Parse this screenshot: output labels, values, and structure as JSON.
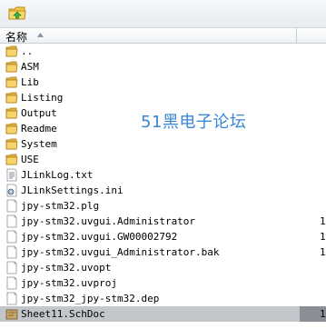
{
  "header": {
    "name_column": "名称"
  },
  "watermark": "51黑电子论坛",
  "files": [
    {
      "name": "..",
      "type": "folder",
      "size": ""
    },
    {
      "name": "ASM",
      "type": "folder",
      "size": ""
    },
    {
      "name": "Lib",
      "type": "folder",
      "size": ""
    },
    {
      "name": "Listing",
      "type": "folder",
      "size": ""
    },
    {
      "name": "Output",
      "type": "folder",
      "size": ""
    },
    {
      "name": "Readme",
      "type": "folder",
      "size": ""
    },
    {
      "name": "System",
      "type": "folder",
      "size": ""
    },
    {
      "name": "USE",
      "type": "folder",
      "size": ""
    },
    {
      "name": "JLinkLog.txt",
      "type": "text",
      "size": ""
    },
    {
      "name": "JLinkSettings.ini",
      "type": "settings",
      "size": ""
    },
    {
      "name": "jpy-stm32.plg",
      "type": "file",
      "size": ""
    },
    {
      "name": "jpy-stm32.uvgui.Administrator",
      "type": "file",
      "size": "1"
    },
    {
      "name": "jpy-stm32.uvgui.GW00002792",
      "type": "file",
      "size": "1"
    },
    {
      "name": "jpy-stm32.uvgui_Administrator.bak",
      "type": "file",
      "size": "1"
    },
    {
      "name": "jpy-stm32.uvopt",
      "type": "file",
      "size": ""
    },
    {
      "name": "jpy-stm32.uvproj",
      "type": "file",
      "size": ""
    },
    {
      "name": "jpy-stm32_jpy-stm32.dep",
      "type": "file",
      "size": ""
    },
    {
      "name": "Sheet11.SchDoc",
      "type": "schdoc",
      "size": "1",
      "selected": true
    }
  ]
}
